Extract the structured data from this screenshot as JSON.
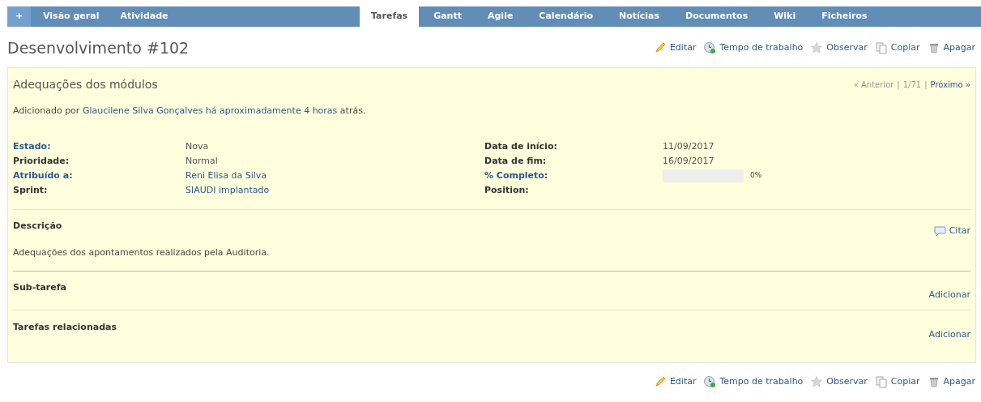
{
  "main_menu": [
    {
      "label": "+",
      "kind": "new"
    },
    {
      "label": "Visão geral",
      "kind": "link"
    },
    {
      "label": "Atividade",
      "kind": "link"
    }
  ],
  "tabs": [
    {
      "label": "Tarefas",
      "selected": true
    },
    {
      "label": "Gantt",
      "selected": false
    },
    {
      "label": "Agile",
      "selected": false
    },
    {
      "label": "Calendário",
      "selected": false
    },
    {
      "label": "Notícias",
      "selected": false
    },
    {
      "label": "Documentos",
      "selected": false
    },
    {
      "label": "Wiki",
      "selected": false
    },
    {
      "label": "Ficheiros",
      "selected": false
    }
  ],
  "title": "Desenvolvimento #102",
  "actions_top": [
    {
      "label": "Editar",
      "kind": "edit"
    },
    {
      "label": "Tempo de trabalho",
      "kind": "time"
    },
    {
      "label": "Observar",
      "kind": "watch"
    },
    {
      "label": "Copiar",
      "kind": "copy"
    },
    {
      "label": "Apagar",
      "kind": "delete"
    }
  ],
  "issue": {
    "subject": "Adequações dos módulos",
    "nav": {
      "previous": "« Anterior",
      "separator_1": "|",
      "position": "1/71",
      "separator_2": "|",
      "next": "Próximo »"
    },
    "author_line": {
      "prefix": "Adicionado por",
      "author": "Glaucilene Silva Gonçalves",
      "age": "há aproximadamente 4 horas",
      "suffix": "atrás."
    },
    "attributes_left": [
      {
        "label": "Estado:",
        "value": "Nova",
        "label_link": true,
        "value_link": false
      },
      {
        "label": "Prioridade:",
        "value": "Normal",
        "label_link": false,
        "value_link": false
      },
      {
        "label": "Atribuído a:",
        "value": "Reni Elisa da Silva",
        "label_link": true,
        "value_link": true
      },
      {
        "label": "Sprint:",
        "value": "SIAUDI implantado",
        "label_link": false,
        "value_link": true
      }
    ],
    "attributes_right": [
      {
        "label": "Data de início:",
        "kind": "text",
        "value": "11/09/2017",
        "label_link": false
      },
      {
        "label": "Data de fim:",
        "kind": "text",
        "value": "16/09/2017",
        "label_link": false
      },
      {
        "label": "% Completo:",
        "kind": "progress",
        "level": 0,
        "value": "0%",
        "label_link": true
      },
      {
        "label": "Position:",
        "kind": "text",
        "label_link": false
      }
    ],
    "description": {
      "heading": "Descrição",
      "quote": "Citar",
      "text": "Adequações dos apontamentos realizados pela Auditoria."
    },
    "sections": [
      {
        "heading": "Sub-tarefa",
        "action": "Adicionar"
      },
      {
        "heading": "Tarefas relacionadas",
        "action": "Adicionar"
      }
    ]
  },
  "actions_bottom": [
    {
      "label": "Editar",
      "kind": "edit"
    },
    {
      "label": "Tempo de trabalho",
      "kind": "time"
    },
    {
      "label": "Observar",
      "kind": "watch"
    },
    {
      "label": "Copiar",
      "kind": "copy"
    },
    {
      "label": "Apagar",
      "kind": "delete"
    }
  ]
}
